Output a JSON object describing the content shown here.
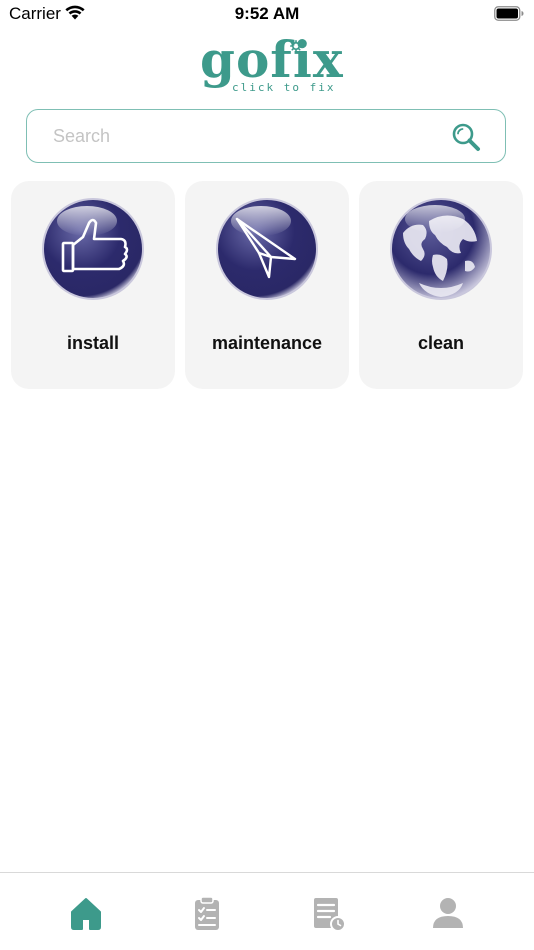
{
  "status_bar": {
    "carrier": "Carrier",
    "time": "9:52 AM"
  },
  "logo": {
    "word": "gofix",
    "tagline": "click to fix",
    "color": "#3d9a8b"
  },
  "search": {
    "placeholder": "Search",
    "value": "",
    "icon": "search-icon"
  },
  "categories": [
    {
      "label": "install",
      "icon": "thumbs-up-icon"
    },
    {
      "label": "maintenance",
      "icon": "paper-plane-icon"
    },
    {
      "label": "clean",
      "icon": "globe-icon"
    }
  ],
  "tab_bar": {
    "active": "home",
    "active_color": "#3d9a8b",
    "inactive_color": "#b3b3b3",
    "tabs": [
      {
        "id": "home",
        "icon": "home-icon"
      },
      {
        "id": "orders",
        "icon": "clipboard-check-icon"
      },
      {
        "id": "history",
        "icon": "document-clock-icon"
      },
      {
        "id": "profile",
        "icon": "user-icon"
      }
    ]
  }
}
